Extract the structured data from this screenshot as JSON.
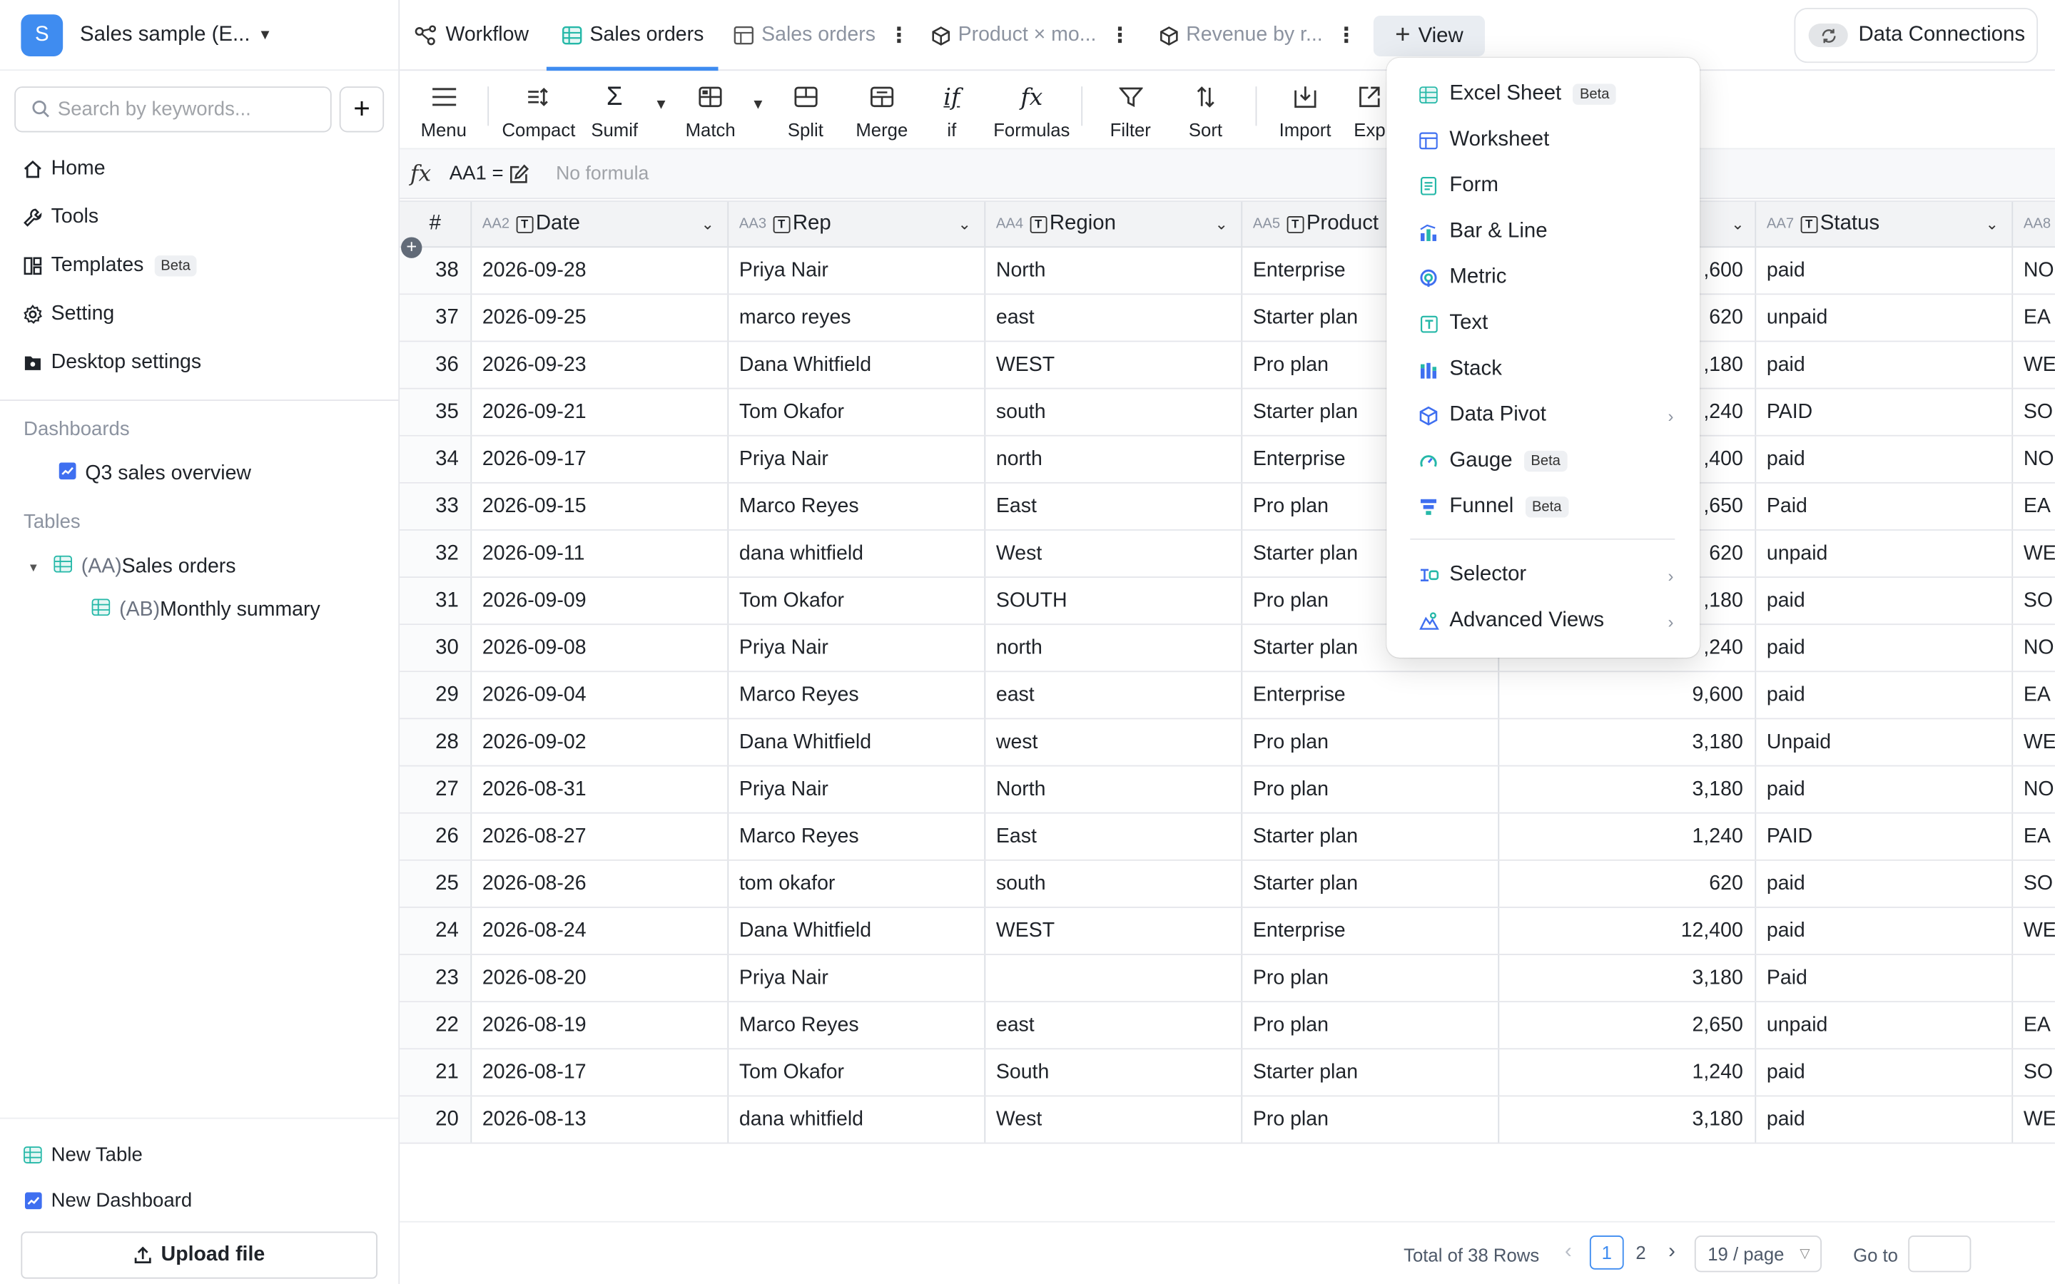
{
  "colors": {
    "accent": "#3f8cf0",
    "teal": "#25b8a8",
    "avatar": "#3f8cf0"
  },
  "workspace": {
    "initial": "S",
    "name": "Sales sample (E..."
  },
  "search": {
    "placeholder": "Search by keywords..."
  },
  "sidebar": {
    "nav": [
      {
        "label": "Home",
        "icon": "home-icon"
      },
      {
        "label": "Tools",
        "icon": "wrench-icon"
      },
      {
        "label": "Templates",
        "icon": "templates-icon",
        "badge": "Beta"
      },
      {
        "label": "Setting",
        "icon": "gear-icon"
      },
      {
        "label": "Desktop settings",
        "icon": "desktop-settings-icon"
      }
    ],
    "dashboards_title": "Dashboards",
    "dashboards": [
      {
        "label": "Q3 sales overview"
      }
    ],
    "tables_title": "Tables",
    "tables": [
      {
        "prefix": "(AA)",
        "label": "Sales orders"
      },
      {
        "prefix": "(AB)",
        "label": "Monthly summary"
      }
    ],
    "new_table": "New Table",
    "new_dashboard": "New Dashboard",
    "upload": "Upload file"
  },
  "tabs": [
    {
      "label": "Workflow",
      "icon": "workflow-icon"
    },
    {
      "label": "Sales orders",
      "icon": "sheet-icon",
      "active": true
    },
    {
      "label": "Sales orders",
      "icon": "worksheet-icon"
    },
    {
      "label": "Product × mo...",
      "icon": "cube-icon"
    },
    {
      "label": "Revenue by r...",
      "icon": "cube-icon"
    }
  ],
  "view_button": "View",
  "data_connections": "Data Connections",
  "toolbar": {
    "menu": "Menu",
    "compact": "Compact",
    "sumif": "Sumif",
    "match": "Match",
    "split": "Split",
    "merge": "Merge",
    "if": "if",
    "formulas": "Formulas",
    "filter": "Filter",
    "sort": "Sort",
    "import": "Import",
    "export": "Exp"
  },
  "formula": {
    "cell_ref": "AA1 =",
    "placeholder": "No formula"
  },
  "grid": {
    "num_header": "#",
    "columns": [
      {
        "id": "AA2",
        "name": "Date"
      },
      {
        "id": "AA3",
        "name": "Rep"
      },
      {
        "id": "AA4",
        "name": "Region"
      },
      {
        "id": "AA5",
        "name": "Product"
      },
      {
        "id": "",
        "name": ""
      },
      {
        "id": "AA7",
        "name": "Status"
      },
      {
        "id": "AA8",
        "name": ""
      }
    ],
    "rows": [
      {
        "n": "38",
        "date": "2026-09-28",
        "rep": "Priya Nair",
        "region": "North",
        "product": "Enterprise",
        "amount": ",600",
        "status": "paid",
        "aa8": "NO"
      },
      {
        "n": "37",
        "date": "2026-09-25",
        "rep": "marco reyes",
        "region": "east",
        "product": "Starter plan",
        "amount": "620",
        "status": "unpaid",
        "aa8": "EA"
      },
      {
        "n": "36",
        "date": "2026-09-23",
        "rep": "Dana Whitfield",
        "region": "WEST",
        "product": "Pro plan",
        "amount": ",180",
        "status": "paid",
        "aa8": "WE"
      },
      {
        "n": "35",
        "date": "2026-09-21",
        "rep": "Tom Okafor",
        "region": "south",
        "product": "Starter plan",
        "amount": ",240",
        "status": "PAID",
        "aa8": "SO"
      },
      {
        "n": "34",
        "date": "2026-09-17",
        "rep": "Priya Nair",
        "region": "north",
        "product": "Enterprise",
        "amount": ",400",
        "status": "paid",
        "aa8": "NO"
      },
      {
        "n": "33",
        "date": "2026-09-15",
        "rep": "Marco Reyes",
        "region": "East",
        "product": "Pro plan",
        "amount": ",650",
        "status": "Paid",
        "aa8": "EA"
      },
      {
        "n": "32",
        "date": "2026-09-11",
        "rep": "dana whitfield",
        "region": "West",
        "product": "Starter plan",
        "amount": "620",
        "status": "unpaid",
        "aa8": "WE"
      },
      {
        "n": "31",
        "date": "2026-09-09",
        "rep": "Tom Okafor",
        "region": "SOUTH",
        "product": "Pro plan",
        "amount": ",180",
        "status": "paid",
        "aa8": "SO"
      },
      {
        "n": "30",
        "date": "2026-09-08",
        "rep": "Priya Nair",
        "region": "north",
        "product": "Starter plan",
        "amount": ",240",
        "status": "paid",
        "aa8": "NO"
      },
      {
        "n": "29",
        "date": "2026-09-04",
        "rep": "Marco Reyes",
        "region": "east",
        "product": "Enterprise",
        "amount": "9,600",
        "status": "paid",
        "aa8": "EA"
      },
      {
        "n": "28",
        "date": "2026-09-02",
        "rep": "Dana Whitfield",
        "region": "west",
        "product": "Pro plan",
        "amount": "3,180",
        "status": "Unpaid",
        "aa8": "WE"
      },
      {
        "n": "27",
        "date": "2026-08-31",
        "rep": "Priya Nair",
        "region": "North",
        "product": "Pro plan",
        "amount": "3,180",
        "status": "paid",
        "aa8": "NO"
      },
      {
        "n": "26",
        "date": "2026-08-27",
        "rep": "Marco Reyes",
        "region": "East",
        "product": "Starter plan",
        "amount": "1,240",
        "status": "PAID",
        "aa8": "EA"
      },
      {
        "n": "25",
        "date": "2026-08-26",
        "rep": "tom okafor",
        "region": "south",
        "product": "Starter plan",
        "amount": "620",
        "status": "paid",
        "aa8": "SO"
      },
      {
        "n": "24",
        "date": "2026-08-24",
        "rep": "Dana Whitfield",
        "region": "WEST",
        "product": "Enterprise",
        "amount": "12,400",
        "status": "paid",
        "aa8": "WE"
      },
      {
        "n": "23",
        "date": "2026-08-20",
        "rep": "Priya Nair",
        "region": "",
        "product": "Pro plan",
        "amount": "3,180",
        "status": "Paid",
        "aa8": ""
      },
      {
        "n": "22",
        "date": "2026-08-19",
        "rep": "Marco Reyes",
        "region": "east",
        "product": "Pro plan",
        "amount": "2,650",
        "status": "unpaid",
        "aa8": "EA"
      },
      {
        "n": "21",
        "date": "2026-08-17",
        "rep": "Tom Okafor",
        "region": "South",
        "product": "Starter plan",
        "amount": "1,240",
        "status": "paid",
        "aa8": "SO"
      },
      {
        "n": "20",
        "date": "2026-08-13",
        "rep": "dana whitfield",
        "region": "West",
        "product": "Pro plan",
        "amount": "3,180",
        "status": "paid",
        "aa8": "WE"
      }
    ]
  },
  "pagination": {
    "total": "Total of 38 Rows",
    "pages": [
      "1",
      "2"
    ],
    "current": "1",
    "page_size": "19 / page",
    "goto": "Go to"
  },
  "view_menu": {
    "items": [
      {
        "label": "Excel Sheet",
        "icon": "excel-sheet-icon",
        "badge": "Beta"
      },
      {
        "label": "Worksheet",
        "icon": "worksheet-icon"
      },
      {
        "label": "Form",
        "icon": "form-icon"
      },
      {
        "label": "Bar & Line",
        "icon": "bar-line-icon"
      },
      {
        "label": "Metric",
        "icon": "metric-icon"
      },
      {
        "label": "Text",
        "icon": "text-icon"
      },
      {
        "label": "Stack",
        "icon": "stack-icon"
      },
      {
        "label": "Data Pivot",
        "icon": "data-pivot-icon",
        "submenu": true
      },
      {
        "label": "Gauge",
        "icon": "gauge-icon",
        "badge": "Beta"
      },
      {
        "label": "Funnel",
        "icon": "funnel-icon",
        "badge": "Beta"
      }
    ],
    "extra": [
      {
        "label": "Selector",
        "icon": "selector-icon",
        "submenu": true
      },
      {
        "label": "Advanced Views",
        "icon": "advanced-views-icon",
        "submenu": true
      }
    ]
  }
}
